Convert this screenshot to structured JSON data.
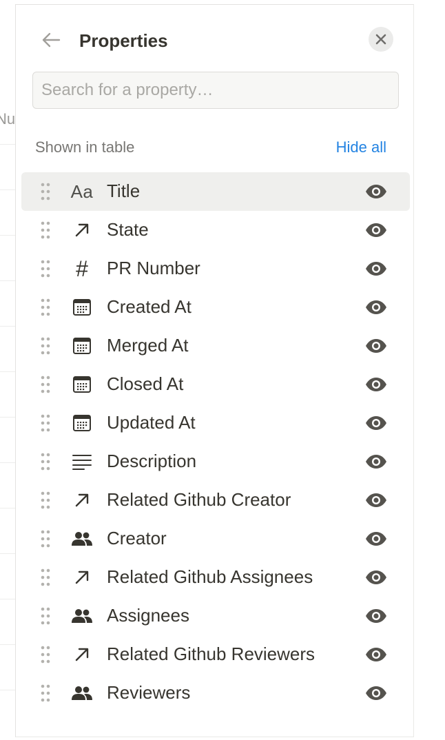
{
  "background": {
    "column_header_fragment": "Nu"
  },
  "panel": {
    "title": "Properties",
    "search": {
      "placeholder": "Search for a property…",
      "value": ""
    },
    "section_label": "Shown in table",
    "hide_all_label": "Hide all",
    "properties": [
      {
        "name": "Title",
        "type": "title",
        "type_text": "Aa",
        "visible": true,
        "highlighted": true
      },
      {
        "name": "State",
        "type": "relation"
      },
      {
        "name": "PR Number",
        "type": "number",
        "type_text": "#"
      },
      {
        "name": "Created At",
        "type": "date"
      },
      {
        "name": "Merged At",
        "type": "date"
      },
      {
        "name": "Closed At",
        "type": "date"
      },
      {
        "name": "Updated At",
        "type": "date"
      },
      {
        "name": "Description",
        "type": "text"
      },
      {
        "name": "Related Github Creator",
        "type": "relation"
      },
      {
        "name": "Creator",
        "type": "person"
      },
      {
        "name": "Related Github Assignees",
        "type": "relation"
      },
      {
        "name": "Assignees",
        "type": "person"
      },
      {
        "name": "Related Github Reviewers",
        "type": "relation"
      },
      {
        "name": "Reviewers",
        "type": "person"
      }
    ],
    "icons": {
      "title": "text-aa-icon",
      "relation": "arrow-up-right-icon",
      "number": "hash-icon",
      "date": "calendar-icon",
      "text": "lines-icon",
      "person": "people-icon",
      "visibility": "eye-icon",
      "drag": "drag-handle-icon"
    },
    "colors": {
      "accent": "#2383e2",
      "text": "#37352f",
      "muted": "#787774",
      "highlight": "#efefed"
    }
  }
}
